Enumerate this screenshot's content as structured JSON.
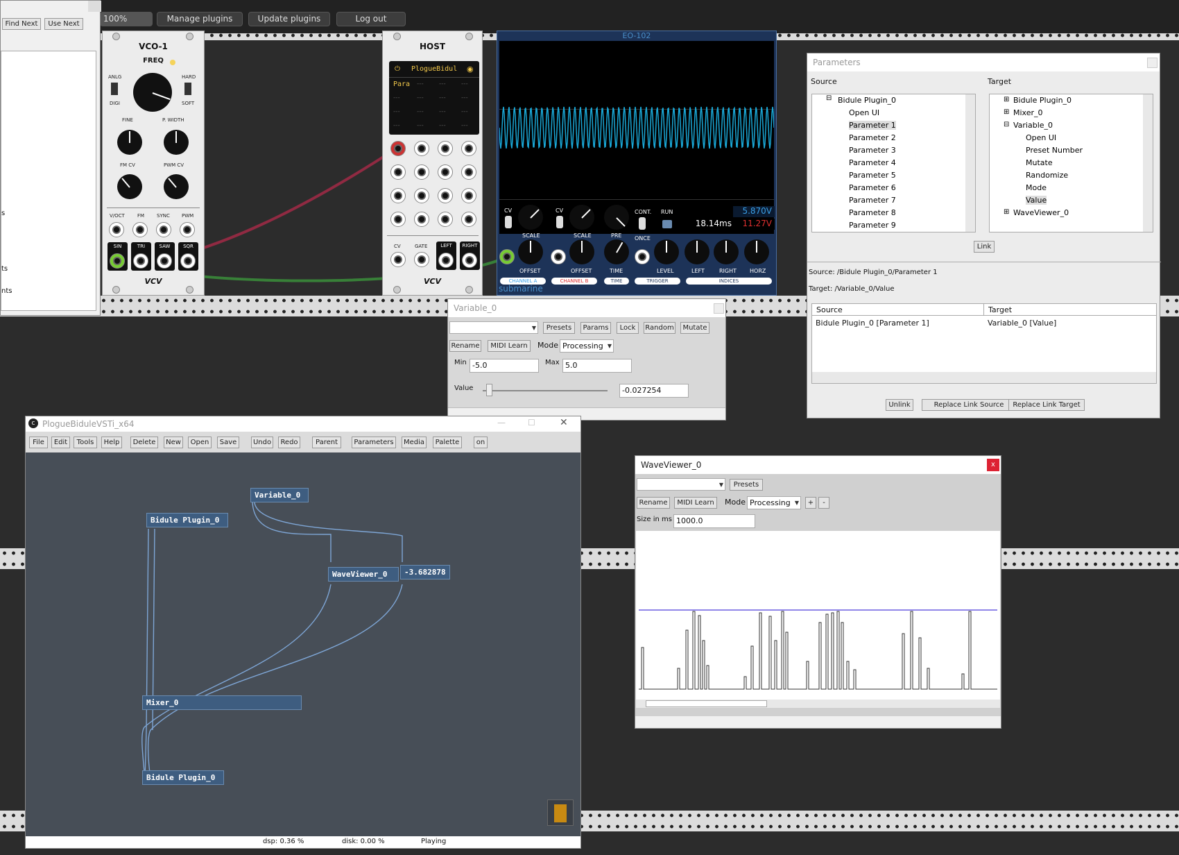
{
  "topbar": {
    "zoom": "100%",
    "manage": "Manage plugins",
    "update": "Update plugins",
    "logout": "Log out"
  },
  "findwin": {
    "find_next": "Find Next",
    "use_next": "Use Next",
    "frag1": "s",
    "frag2": "ts",
    "frag3": "nts"
  },
  "vco": {
    "title": "VCO-1",
    "freq": "FREQ",
    "anlg": "ANLG",
    "digi": "DIGI",
    "hard": "HARD",
    "soft": "SOFT",
    "fine": "FINE",
    "pwidth": "P. WIDTH",
    "fmcv": "FM CV",
    "pwmcv": "PWM CV",
    "voct": "V/OCT",
    "fm": "FM",
    "sync": "SYNC",
    "pwm": "PWM",
    "sin": "SIN",
    "tri": "TRI",
    "saw": "SAW",
    "sqr": "SQR",
    "brand": "VCV"
  },
  "host": {
    "title": "HOST",
    "plugin": "PlogueBidul",
    "para": "Para",
    "dash": "---",
    "cv": "CV",
    "gate": "GATE",
    "left": "LEFT",
    "right": "RIGHT",
    "brand": "VCV"
  },
  "scope": {
    "title": "EO-102",
    "cv": "CV",
    "scale": "SCALE",
    "pre": "PRE",
    "cont": "CONT.",
    "once": "ONCE",
    "run": "RUN",
    "v1": "5.870V",
    "ms": "18.14ms",
    "v2": "11.27V",
    "offset": "OFFSET",
    "time": "TIME",
    "level": "LEVEL",
    "left": "LEFT",
    "right": "RIGHT",
    "horz": "HORZ",
    "cha": "CHANNEL A",
    "chb": "CHANNEL B",
    "time_tab": "TIME",
    "trigger": "TRIGGER",
    "indices": "INDICES",
    "brand": "submarine"
  },
  "params": {
    "title": "Parameters",
    "source": "Source",
    "target": "Target",
    "src_items": [
      "Bidule Plugin_0",
      "Open UI",
      "Parameter   1",
      "Parameter   2",
      "Parameter   3",
      "Parameter   4",
      "Parameter   5",
      "Parameter   6",
      "Parameter   7",
      "Parameter   8",
      "Parameter   9"
    ],
    "tgt_items": [
      "Bidule Plugin_0",
      "Mixer_0",
      "Variable_0",
      "Open UI",
      "Preset Number",
      "Mutate",
      "Randomize",
      "Mode",
      "Value",
      "WaveViewer_0"
    ],
    "link": "Link",
    "src_path": "Source: /Bidule Plugin_0/Parameter   1",
    "tgt_path": "Target: /Variable_0/Value",
    "col_source": "Source",
    "col_target": "Target",
    "row_source": "Bidule Plugin_0 [Parameter   1]",
    "row_target": "Variable_0 [Value]",
    "unlink": "Unlink",
    "replace_source": "Replace Link Source",
    "replace_target": "Replace Link Target"
  },
  "variable": {
    "title": "Variable_0",
    "presets": "Presets",
    "params": "Params",
    "lock": "Lock",
    "random": "Random",
    "mutate": "Mutate",
    "rename": "Rename",
    "midi": "MIDI Learn",
    "mode_label": "Mode",
    "mode": "Processing",
    "min_label": "Min",
    "min": "-5.0",
    "max_label": "Max",
    "max": "5.0",
    "value_label": "Value",
    "value": "-0.027254",
    "slider_fraction": 0.03
  },
  "bidule": {
    "title": "PlogueBiduleVSTi_x64",
    "menu": [
      "File",
      "Edit",
      "Tools",
      "Help",
      "Delete",
      "New",
      "Open",
      "Save",
      "Undo",
      "Redo",
      "Parent",
      "Parameters",
      "Media",
      "Palette",
      "on"
    ],
    "nodes": {
      "variable": "Variable_0",
      "plugin_top": "Bidule Plugin_0",
      "waveviewer": "WaveViewer_0",
      "value": "-3.682878",
      "mixer": "Mixer_0",
      "plugin_bottom": "Bidule Plugin_0"
    },
    "dsp": "dsp:  0.36 %",
    "disk": "disk:  0.00 %",
    "status": "Playing"
  },
  "waveviewer": {
    "title": "WaveViewer_0",
    "close": "x",
    "presets": "Presets",
    "rename": "Rename",
    "midi": "MIDI Learn",
    "mode_label": "Mode",
    "mode": "Processing",
    "plus": "+",
    "minus": "-",
    "size_label": "Size in ms",
    "size": "1000.0"
  },
  "colors": {
    "accent": "#3e5d80",
    "scope_wave": "#1aa9d8",
    "cable_red": "#9b2a45",
    "cable_green": "#3a8a3a"
  }
}
